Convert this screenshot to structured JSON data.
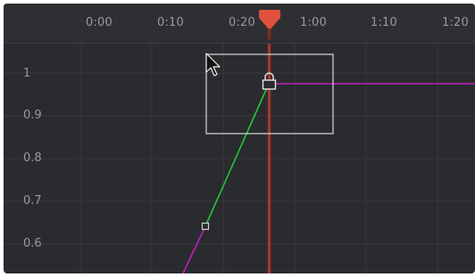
{
  "timeline": {
    "labels": [
      "0:00",
      "0:10",
      "0:20",
      "1:00",
      "1:10",
      "1:20"
    ]
  },
  "axis": {
    "labels": [
      "1",
      "0.9",
      "0.8",
      "0.7",
      "0.6"
    ]
  },
  "colors": {
    "background": "#2a2b2e",
    "ruler": "#2e2f32",
    "grid": "#37383c",
    "playhead": "#e0503c",
    "curve_green": "#23c63a",
    "curve_magenta": "#c21cc2",
    "selection": "#d9d9d9"
  },
  "icons": {
    "playhead": "playhead-marker-icon",
    "lock": "lock-icon",
    "cursor": "arrow-cursor-icon",
    "keyframe": "keyframe-icon"
  }
}
